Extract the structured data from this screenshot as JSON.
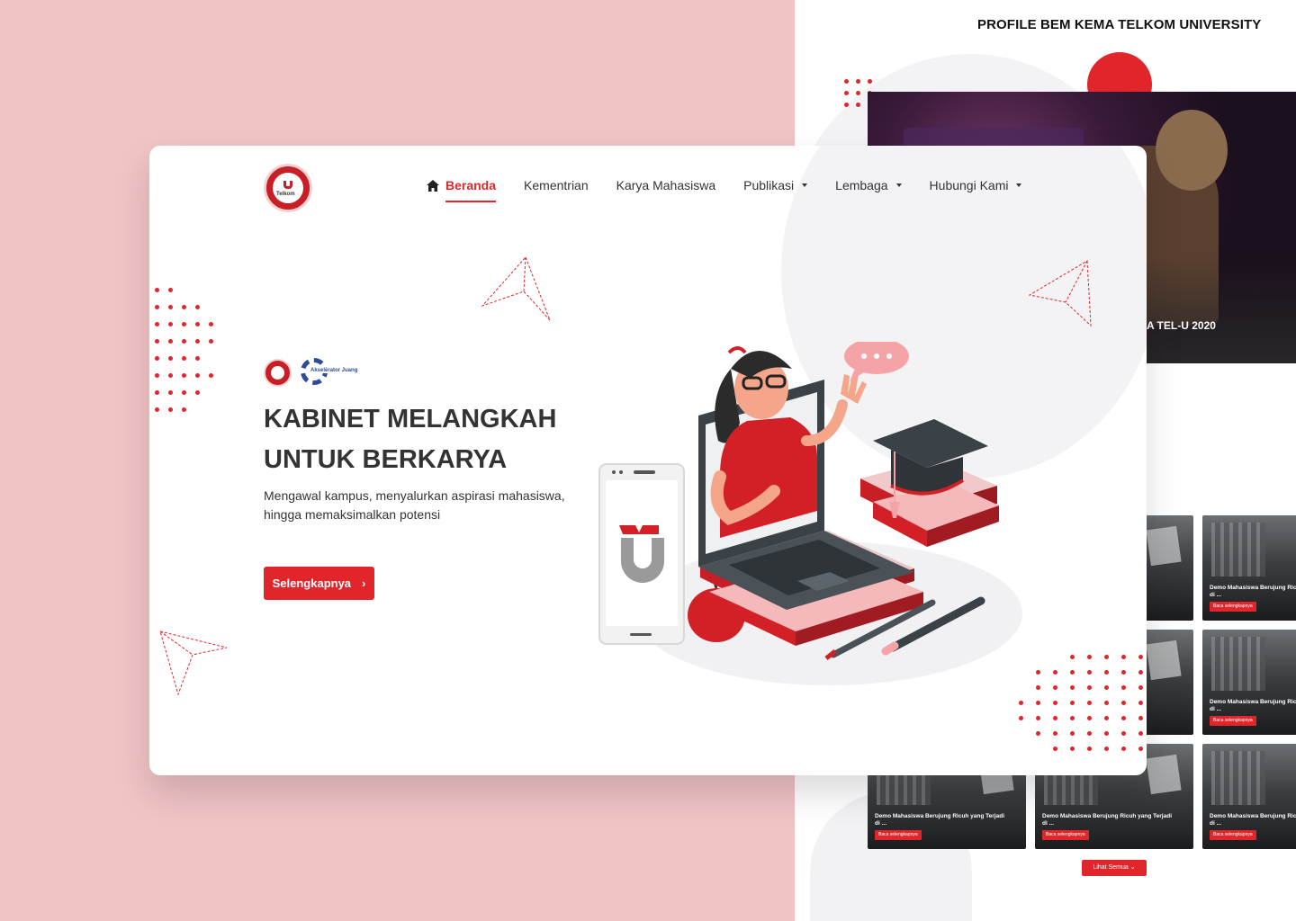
{
  "profile_page": {
    "title": "PROFILE BEM KEMA TELKOM UNIVERSITY",
    "hero_caption": "A TEL-U 2020",
    "news_cards": [
      {
        "title": "Demo Mahasiswa Berujung Ricuh yang Terjadi di ...",
        "button": "Baca selengkapnya"
      },
      {
        "title": "Demo Mahasiswa Berujung Ricuh yang Terjadi di ...",
        "button": "Baca selengkapnya"
      },
      {
        "title": "Demo Mahasiswa Berujung Ricuh yang Terjadi di ...",
        "button": "Baca selengkapnya"
      },
      {
        "title": "Demo Mahasiswa Berujung Ricuh yang Terjadi di ...",
        "button": "Baca selengkapnya"
      },
      {
        "title": "Demo Mahasiswa Berujung Ricuh yang Terjadi di ...",
        "button": "Baca selengkapnya"
      },
      {
        "title": "Demo Mahasiswa Berujung Ricuh yang Terjadi di ...",
        "button": "Baca selengkapnya"
      }
    ],
    "view_all": "Lihat Semua"
  },
  "nav": {
    "items": [
      {
        "label": "Beranda",
        "icon": "home-icon",
        "active": true
      },
      {
        "label": "Kementrian"
      },
      {
        "label": "Karya Mahasiswa"
      },
      {
        "label": "Publikasi",
        "dropdown": true
      },
      {
        "label": "Lembaga",
        "dropdown": true
      },
      {
        "label": "Hubungi Kami",
        "dropdown": true
      }
    ]
  },
  "logos": {
    "main_text": "Telkom",
    "partner_text": "Akselerator Juang"
  },
  "hero": {
    "title_line1": "KABINET MELANGKAH",
    "title_line2": "UNTUK BERKARYA",
    "subtitle": "Mengawal kampus, menyalurkan aspirasi mahasiswa, hingga memaksimalkan potensi",
    "cta_label": "Selengkapnya",
    "cta_icon": "chevron-right-icon"
  },
  "colors": {
    "accent": "#e1262b",
    "background_pink": "#f0c3c5",
    "text": "#333333"
  }
}
